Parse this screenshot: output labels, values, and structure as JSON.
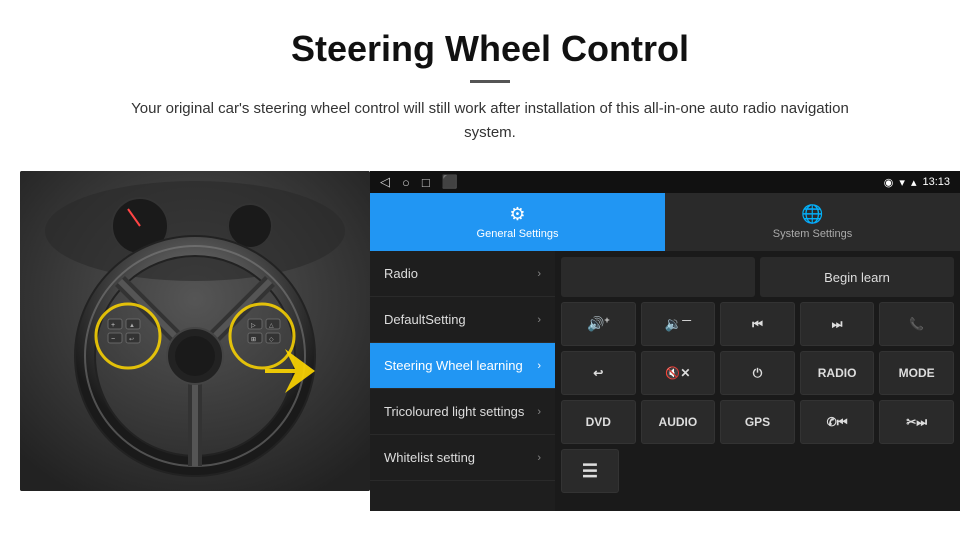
{
  "header": {
    "title": "Steering Wheel Control",
    "description": "Your original car's steering wheel control will still work after installation of this all-in-one auto radio navigation system."
  },
  "status_bar": {
    "nav_back": "◁",
    "nav_home": "○",
    "nav_square": "□",
    "nav_other": "⬛",
    "wifi_icon": "▼",
    "signal_icon": "▲",
    "time": "13:13"
  },
  "tabs": [
    {
      "id": "general",
      "label": "General Settings",
      "icon": "⚙",
      "active": true
    },
    {
      "id": "system",
      "label": "System Settings",
      "icon": "🌐",
      "active": false
    }
  ],
  "menu_items": [
    {
      "id": "radio",
      "label": "Radio",
      "active": false
    },
    {
      "id": "default",
      "label": "DefaultSetting",
      "active": false
    },
    {
      "id": "steering",
      "label": "Steering Wheel learning",
      "active": true
    },
    {
      "id": "tricoloured",
      "label": "Tricoloured light settings",
      "active": false
    },
    {
      "id": "whitelist",
      "label": "Whitelist setting",
      "active": false
    }
  ],
  "controls": {
    "begin_learn": "Begin learn",
    "row2": [
      {
        "id": "vol_up",
        "icon": "🔊+",
        "text": "▐+",
        "type": "icon"
      },
      {
        "id": "vol_down",
        "icon": "🔉-",
        "text": "▐—",
        "type": "icon"
      },
      {
        "id": "prev_track",
        "icon": "⏮",
        "text": "⏮",
        "type": "icon"
      },
      {
        "id": "next_track",
        "icon": "⏭",
        "text": "⏭",
        "type": "icon"
      },
      {
        "id": "phone",
        "icon": "📞",
        "text": "✆",
        "type": "icon"
      }
    ],
    "row3": [
      {
        "id": "back",
        "icon": "↩",
        "text": "↩",
        "type": "icon"
      },
      {
        "id": "mute",
        "icon": "🔇",
        "text": "▐✕",
        "type": "icon"
      },
      {
        "id": "power",
        "icon": "⏻",
        "text": "⏻",
        "type": "icon"
      },
      {
        "id": "radio_btn",
        "text": "RADIO",
        "type": "text"
      },
      {
        "id": "mode_btn",
        "text": "MODE",
        "type": "text"
      }
    ],
    "row4": [
      {
        "id": "dvd_btn",
        "text": "DVD",
        "type": "text"
      },
      {
        "id": "audio_btn",
        "text": "AUDIO",
        "type": "text"
      },
      {
        "id": "gps_btn",
        "text": "GPS",
        "type": "text"
      },
      {
        "id": "prev_track2",
        "icon": "⏮",
        "text": "✆⏮",
        "type": "icon"
      },
      {
        "id": "next_track2",
        "icon": "⏭",
        "text": "✂⏭",
        "type": "icon"
      }
    ],
    "row5": [
      {
        "id": "list_icon",
        "text": "≡",
        "type": "icon"
      }
    ]
  }
}
